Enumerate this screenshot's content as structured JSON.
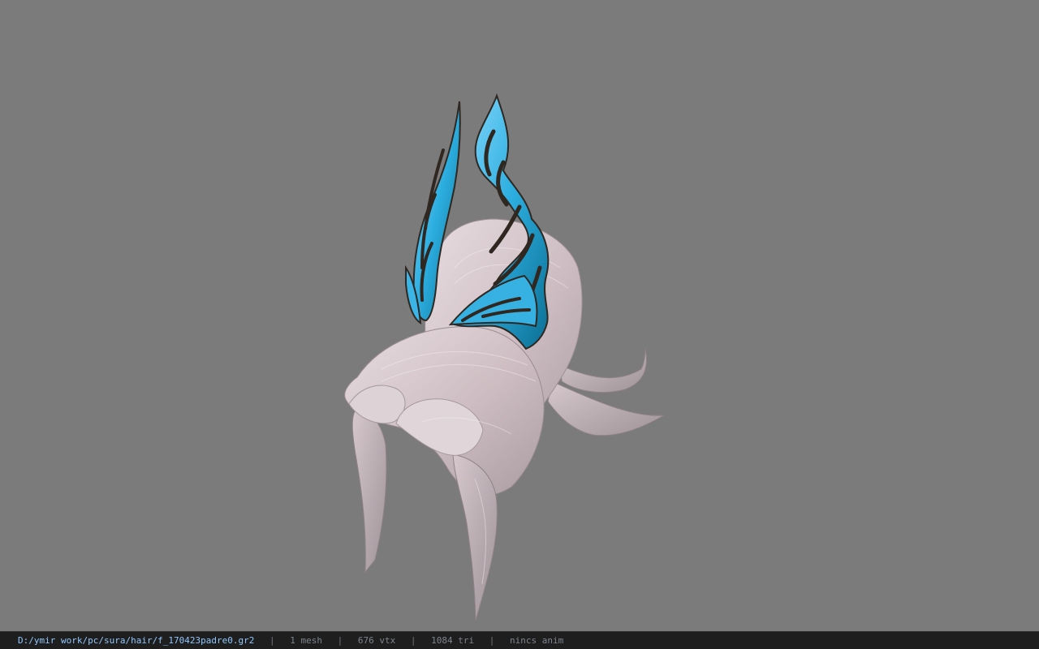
{
  "status": {
    "path": "D:/ymir work/pc/sura/hair/f_170423padre0.gr2",
    "mesh": "1 mesh",
    "vertices": "676 vtx",
    "triangles": "1084 tri",
    "anim": "nincs anim"
  },
  "scene": {
    "model_name": "hair-model",
    "background_color": "#7b7b7b",
    "hair_color": "#cbbbc0",
    "accent_color": "#48bfe8",
    "dark_stripe_color": "#2f2720"
  }
}
